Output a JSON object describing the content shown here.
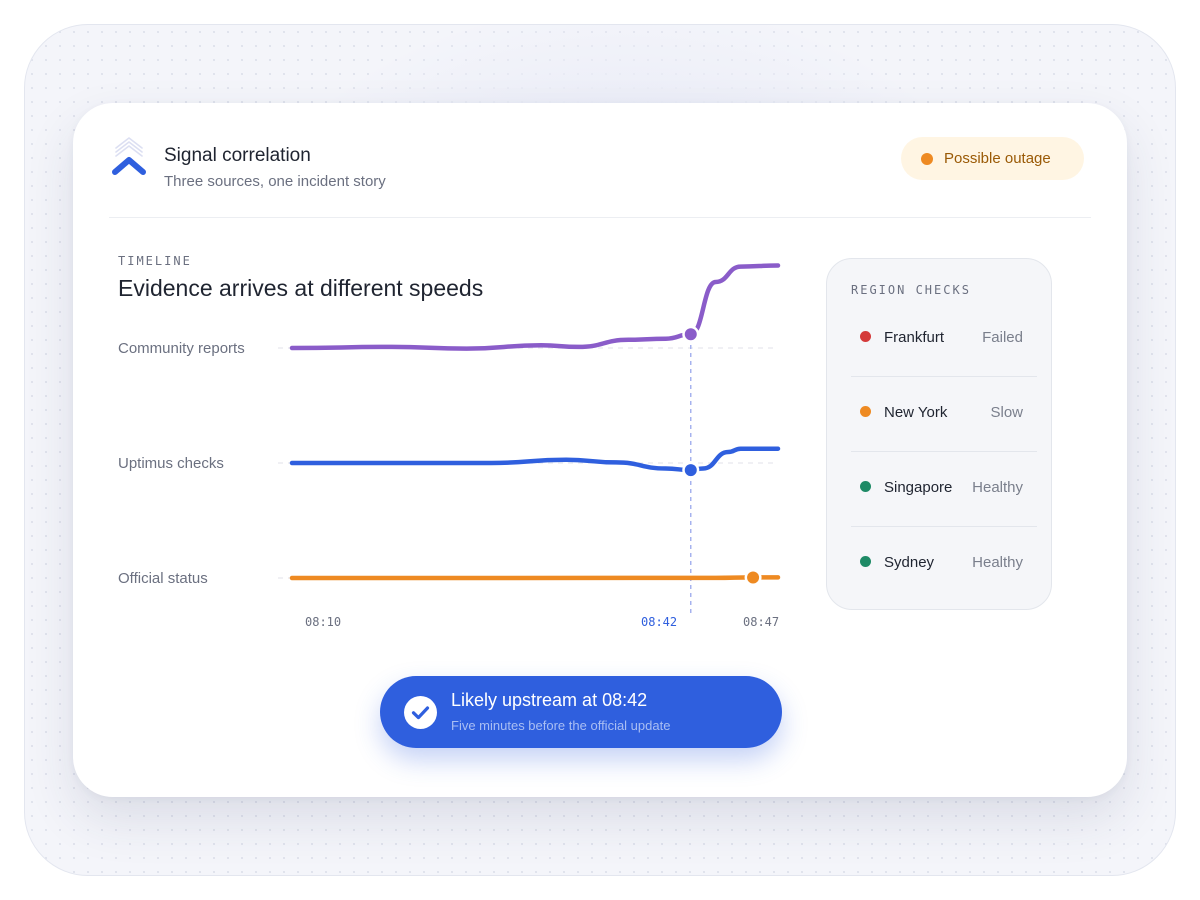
{
  "header": {
    "title": "Signal correlation",
    "subtitle": "Three sources, one incident story",
    "status": {
      "label": "Possible outage",
      "color": "#ee8a22"
    }
  },
  "timeline": {
    "kicker": "TIMELINE",
    "title": "Evidence arrives at different speeds"
  },
  "chart_data": {
    "type": "line",
    "x_ticks": [
      {
        "label": "08:10",
        "highlight": false
      },
      {
        "label": "08:42",
        "highlight": true
      },
      {
        "label": "08:47",
        "highlight": false
      }
    ],
    "marker_time": "08:42",
    "series": [
      {
        "name": "Community reports",
        "color": "#8a5cc9",
        "points": [
          [
            "08:10",
            0
          ],
          [
            "08:18",
            0.02
          ],
          [
            "08:24",
            -0.01
          ],
          [
            "08:30",
            0.05
          ],
          [
            "08:33",
            0.02
          ],
          [
            "08:37",
            0.15
          ],
          [
            "08:40",
            0.17
          ],
          [
            "08:42",
            0.25
          ],
          [
            "08:44",
            1.2
          ],
          [
            "08:46",
            1.48
          ],
          [
            "08:49",
            1.5
          ]
        ],
        "marker": {
          "time": "08:42",
          "value": 0.25
        }
      },
      {
        "name": "Uptimus checks",
        "color": "#2f5fde",
        "points": [
          [
            "08:10",
            0
          ],
          [
            "08:26",
            0
          ],
          [
            "08:32",
            0.06
          ],
          [
            "08:36",
            0.01
          ],
          [
            "08:40",
            -0.1
          ],
          [
            "08:42",
            -0.13
          ],
          [
            "08:43",
            -0.1
          ],
          [
            "08:45",
            0.2
          ],
          [
            "08:46",
            0.26
          ],
          [
            "08:49",
            0.26
          ]
        ],
        "marker": {
          "time": "08:42",
          "value": -0.13
        }
      },
      {
        "name": "Official status",
        "color": "#ee8a22",
        "points": [
          [
            "08:10",
            0
          ],
          [
            "08:44",
            0.002
          ],
          [
            "08:47",
            0.01
          ],
          [
            "08:49",
            0.01
          ]
        ],
        "marker": {
          "time": "08:47",
          "value": 0.01
        }
      }
    ]
  },
  "regions": {
    "kicker": "REGION CHECKS",
    "items": [
      {
        "name": "Frankfurt",
        "state": "Failed",
        "color": "#d43a3a"
      },
      {
        "name": "New York",
        "state": "Slow",
        "color": "#ee8a22"
      },
      {
        "name": "Singapore",
        "state": "Healthy",
        "color": "#1e8a66"
      },
      {
        "name": "Sydney",
        "state": "Healthy",
        "color": "#1e8a66"
      }
    ]
  },
  "toast": {
    "title": "Likely upstream at 08:42",
    "subtitle": "Five minutes before the official update"
  }
}
